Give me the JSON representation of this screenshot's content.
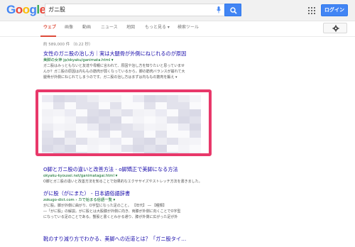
{
  "header": {
    "logo": "Google",
    "logo_letters": [
      {
        "ch": "G",
        "color": "#4285f4"
      },
      {
        "ch": "o",
        "color": "#ea4335"
      },
      {
        "ch": "o",
        "color": "#fbbc05"
      },
      {
        "ch": "g",
        "color": "#4285f4"
      },
      {
        "ch": "l",
        "color": "#34a853"
      },
      {
        "ch": "e",
        "color": "#ea4335"
      }
    ],
    "search_value": "ガニ股",
    "login_label": "ログイン"
  },
  "tabs": [
    {
      "label": "ウェブ",
      "active": true
    },
    {
      "label": "画像",
      "active": false
    },
    {
      "label": "動画",
      "active": false
    },
    {
      "label": "ニュース",
      "active": false
    },
    {
      "label": "地図",
      "active": false
    },
    {
      "label": "もっと見る ▾",
      "active": false
    },
    {
      "label": "検索ツール",
      "active": false
    }
  ],
  "stats": "約 589,000 件 （0.22 秒）",
  "results": [
    {
      "title": "女性のガニ股の治し方｜実は大腿骨が外側にねじれるのが原因",
      "url": "美脚の女神 jp/okyaku/ganimata.html ▾",
      "snippets": [
        "ガニ股はみっともないと友達や母親に言われて、原因や治し方を知りたいと思っていませ",
        "んか？ガニ股の原因は内ももの筋肉が弱くなっているから。脚の筋肉バランスが崩れて大",
        "腿骨が外側にねじれてしまうのです。ガニ股の治し方はまずは内ももの筋肉を鍛え ▾"
      ]
    },
    {
      "title": "O脚とガニ股の違いと改善方法 - o脚矯正で美脚になる方法",
      "url": "okyaku-kyousei.net/ganimatagai.html ▾",
      "snippets": [
        "O脚とガニ股の違いと改善方法を知ることで効果的なエクササイズやストレッチ方法を書きました。"
      ]
    },
    {
      "title": "がに股（がにまた） - 日本語俗語辞書",
      "url": "zokugo-dict.com › カで始まる俗語一覧 ▾",
      "snippets": [
        "がに股。脚が外側に曲がり、O字型になった足のこと。 【年代】 ― 【種類】",
        "―「がに股」の解説。がに股とは大股膝が外側に向き、両膝が外側に向くことでO字型",
        "になっている足のことである。蟹股と書くとわかる通り、膝が外側に広がった足が外"
      ]
    },
    {
      "title": "靴のすり減り方でわかる、美脚への近道とは？「ガニ股タイ…"
    }
  ],
  "blur_colors": [
    "#ebebf3",
    "#e2e2ec",
    "#f2f2f6",
    "#d9d9e6",
    "#ececf2",
    "#fafafc",
    "#dedee9",
    "#f4f4f8"
  ]
}
